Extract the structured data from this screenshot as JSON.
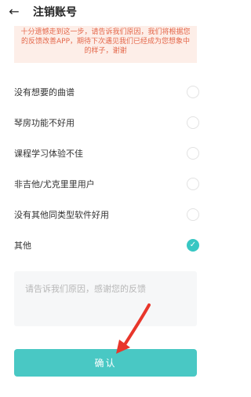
{
  "header": {
    "back_icon": "arrow-left-icon",
    "title": "注销账号"
  },
  "notice": {
    "text": "十分遗憾走到这一步，请告诉我们原因，我们将根据您的反馈改善APP，期待下次遇见我们已经成为您想象中的样子，谢谢"
  },
  "reasons": [
    {
      "label": "没有想要的曲谱",
      "checked": false
    },
    {
      "label": "琴房功能不好用",
      "checked": false
    },
    {
      "label": "课程学习体验不佳",
      "checked": false
    },
    {
      "label": "非吉他/尤克里里用户",
      "checked": false
    },
    {
      "label": "没有其他同类型软件好用",
      "checked": false
    },
    {
      "label": "其他",
      "checked": true
    }
  ],
  "feedback": {
    "placeholder": "请告诉我们原因，感谢您的反馈"
  },
  "confirm": {
    "label": "确认"
  },
  "colors": {
    "accent": "#38c7c3",
    "notice_bg": "#fdeee8",
    "notice_text": "#e4674a",
    "arrow": "#e8362b"
  }
}
